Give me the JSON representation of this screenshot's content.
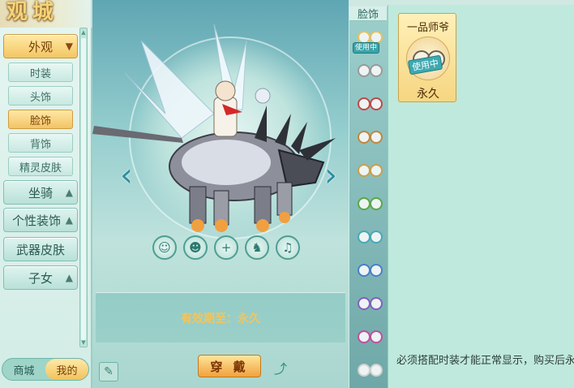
{
  "sidebar": {
    "logo": "观城",
    "categories": {
      "appearance": "外观",
      "mount": "坐骑",
      "personal_decor": "个性装饰",
      "weapon_skin": "武器皮肤",
      "children": "子女"
    },
    "subitems": [
      "时装",
      "头饰",
      "脸饰",
      "背饰",
      "精灵皮肤"
    ],
    "active_subitem": "脸饰",
    "bottom_tabs": {
      "shop": "商城",
      "mine": "我的"
    }
  },
  "preview": {
    "validity": "有效期至：永久",
    "wear_button": "穿 戴"
  },
  "strip": {
    "header": "脸饰",
    "in_use": "使用中",
    "item_colors": [
      "#e8c060",
      "#9a9a9a",
      "#c04848",
      "#c08840",
      "#c8a050",
      "#5aa848",
      "#48a8b8",
      "#4880c8",
      "#8060c0",
      "#c050a0",
      "#d0d0d0"
    ]
  },
  "detail": {
    "item_name": "一品师爷",
    "in_use": "使用中",
    "duration": "永久",
    "note": "必须搭配时装才能正常显示，购买后永久持有"
  },
  "colors": {
    "accent_gold": "#f2c464",
    "teal": "#3ba3a8"
  }
}
